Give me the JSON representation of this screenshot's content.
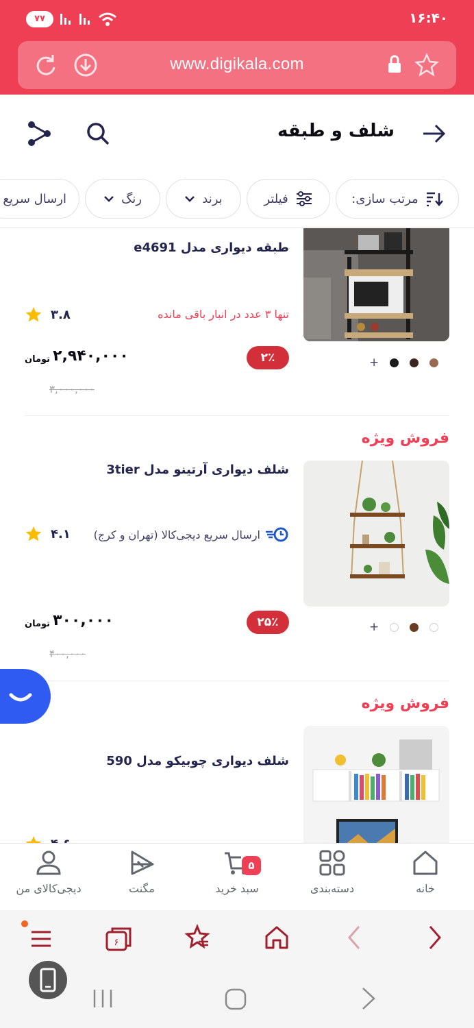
{
  "status": {
    "time": "۱۶:۴۰",
    "battery": "۷۷"
  },
  "browser": {
    "url": "www.digikala.com"
  },
  "page": {
    "title": "شلف و طبقه"
  },
  "filters": [
    {
      "label": "مرتب سازی:",
      "icon": "sort-icon"
    },
    {
      "label": "فیلتر",
      "icon": "sliders-icon"
    },
    {
      "label": "برند",
      "icon": "chevron-down-icon"
    },
    {
      "label": "رنگ",
      "icon": "chevron-down-icon"
    },
    {
      "label": "ارسال سریع",
      "icon": ""
    }
  ],
  "products": [
    {
      "name": "طبقه دیواری مدل e4691",
      "stock_note": "تنها ۳ عدد در انبار باقی مانده",
      "rating": "۳.۸",
      "discount": "۲٪",
      "price": "۲,۹۴۰,۰۰۰",
      "currency": "تومان",
      "old_price": "۳,۰۰۰,۰۰۰",
      "colors": [
        "#9a6a52",
        "#3b2620",
        "#1c1c1c"
      ]
    },
    {
      "badge": "فروش ویژه",
      "name": "شلف دیواری آرتینو مدل 3tier",
      "shipping": "ارسال سریع دیجی‌کالا (تهران و کرج)",
      "rating": "۴.۱",
      "discount": "۲۵٪",
      "price": "۳۰۰,۰۰۰",
      "currency": "تومان",
      "old_price": "۴۰۰,۰۰۰",
      "colors": [
        "#ffffff",
        "#6a3b24",
        "#ffffff"
      ]
    },
    {
      "badge": "فروش ویژه",
      "name": "شلف دیواری چوبیکو مدل 590",
      "rating": "۴.۶"
    }
  ],
  "bottom_nav": [
    {
      "label": "خانه",
      "icon": "home-icon"
    },
    {
      "label": "دسته‌بندی",
      "icon": "category-icon"
    },
    {
      "label": "سبد خرید",
      "icon": "cart-icon",
      "badge": "۵"
    },
    {
      "label": "مگنت",
      "icon": "magnet-icon"
    },
    {
      "label": "دیجی‌کالای من",
      "icon": "user-icon"
    }
  ],
  "browser_toolbar": {
    "tabs_count": "۶"
  },
  "colors": {
    "brand": "#ef3f55",
    "discount": "#d32f3b",
    "star": "#f9bc00"
  }
}
